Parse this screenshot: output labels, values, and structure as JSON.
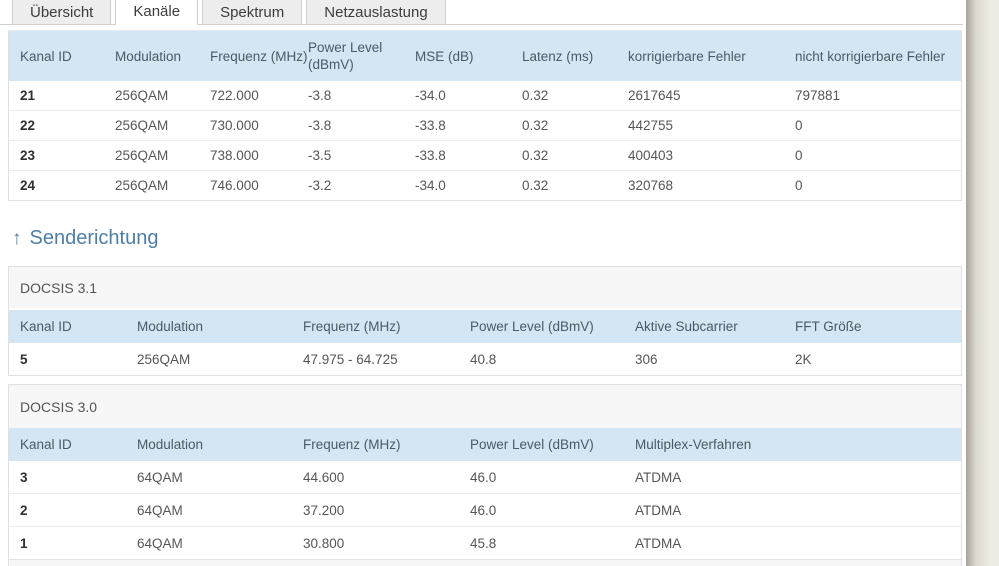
{
  "tabs": [
    {
      "label": "Übersicht",
      "active": false
    },
    {
      "label": "Kanäle",
      "active": true
    },
    {
      "label": "Spektrum",
      "active": false
    },
    {
      "label": "Netzauslastung",
      "active": false
    }
  ],
  "downstream": {
    "columns": [
      "Kanal ID",
      "Modulation",
      "Frequenz (MHz)",
      "Power Level (dBmV)",
      "MSE (dB)",
      "Latenz (ms)",
      "korrigierbare Fehler",
      "nicht korrigierbare Fehler"
    ],
    "rows": [
      [
        "21",
        "256QAM",
        "722.000",
        "-3.8",
        "-34.0",
        "0.32",
        "2617645",
        "797881"
      ],
      [
        "22",
        "256QAM",
        "730.000",
        "-3.8",
        "-33.8",
        "0.32",
        "442755",
        "0"
      ],
      [
        "23",
        "256QAM",
        "738.000",
        "-3.5",
        "-33.8",
        "0.32",
        "400403",
        "0"
      ],
      [
        "24",
        "256QAM",
        "746.000",
        "-3.2",
        "-34.0",
        "0.32",
        "320768",
        "0"
      ]
    ]
  },
  "upstream_heading": {
    "arrow": "↑",
    "label": "Senderichtung"
  },
  "docsis31": {
    "title": "DOCSIS 3.1",
    "columns": [
      "Kanal ID",
      "Modulation",
      "Frequenz (MHz)",
      "Power Level (dBmV)",
      "Aktive Subcarrier",
      "FFT Größe"
    ],
    "rows": [
      [
        "5",
        "256QAM",
        "47.975 - 64.725",
        "40.8",
        "306",
        "2K"
      ]
    ]
  },
  "docsis30": {
    "title": "DOCSIS 3.0",
    "columns": [
      "Kanal ID",
      "Modulation",
      "Frequenz (MHz)",
      "Power Level (dBmV)",
      "Multiplex-Verfahren"
    ],
    "rows": [
      [
        "3",
        "64QAM",
        "44.600",
        "46.0",
        "ATDMA"
      ],
      [
        "2",
        "64QAM",
        "37.200",
        "46.0",
        "ATDMA"
      ],
      [
        "1",
        "64QAM",
        "30.800",
        "45.8",
        "ATDMA"
      ]
    ]
  },
  "colors": {
    "table_header_bg": "#d4e6f3",
    "heading_accent": "#4d7ea7",
    "strip_bg": "#f7f7f7",
    "page_edge": "#edebe4"
  }
}
